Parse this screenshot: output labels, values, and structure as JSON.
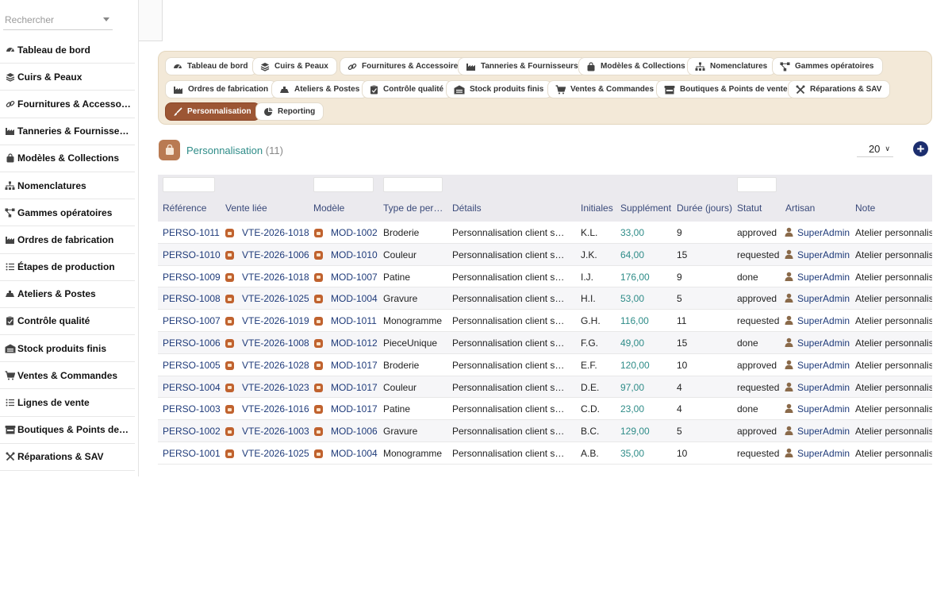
{
  "search": {
    "placeholder": "Rechercher"
  },
  "sidebar": {
    "items": [
      {
        "label": "Tableau de bord",
        "icon": "dashboard-icon"
      },
      {
        "label": "Cuirs & Peaux",
        "icon": "layers-icon"
      },
      {
        "label": "Fournitures & Accessoires",
        "icon": "link-icon"
      },
      {
        "label": "Tanneries & Fournisseurs",
        "icon": "factory-icon"
      },
      {
        "label": "Modèles & Collections",
        "icon": "bag-icon"
      },
      {
        "label": "Nomenclatures",
        "icon": "sitemap-icon"
      },
      {
        "label": "Gammes opératoires",
        "icon": "flow-icon"
      },
      {
        "label": "Ordres de fabrication",
        "icon": "factory-icon"
      },
      {
        "label": "Étapes de production",
        "icon": "list-icon"
      },
      {
        "label": "Ateliers & Postes",
        "icon": "workshop-icon"
      },
      {
        "label": "Contrôle qualité",
        "icon": "clipboard-check-icon"
      },
      {
        "label": "Stock produits finis",
        "icon": "warehouse-icon"
      },
      {
        "label": "Ventes & Commandes",
        "icon": "cart-icon"
      },
      {
        "label": "Lignes de vente",
        "icon": "list-icon"
      },
      {
        "label": "Boutiques & Points de vente",
        "icon": "store-icon"
      },
      {
        "label": "Réparations & SAV",
        "icon": "tools-icon"
      }
    ]
  },
  "tabs": [
    {
      "label": "Tableau de bord",
      "icon": "dashboard-icon"
    },
    {
      "label": "Cuirs & Peaux",
      "icon": "layers-icon"
    },
    {
      "label": "Fournitures & Accessoires",
      "icon": "link-icon"
    },
    {
      "label": "Tanneries & Fournisseurs",
      "icon": "factory-icon"
    },
    {
      "label": "Modèles & Collections",
      "icon": "bag-icon"
    },
    {
      "label": "Nomenclatures",
      "icon": "sitemap-icon"
    },
    {
      "label": "Gammes opératoires",
      "icon": "flow-icon"
    },
    {
      "label": "Ordres de fabrication",
      "icon": "factory-icon"
    },
    {
      "label": "Ateliers & Postes",
      "icon": "workshop-icon"
    },
    {
      "label": "Contrôle qualité",
      "icon": "clipboard-check-icon"
    },
    {
      "label": "Stock produits finis",
      "icon": "warehouse-icon"
    },
    {
      "label": "Ventes & Commandes",
      "icon": "cart-icon"
    },
    {
      "label": "Boutiques & Points de vente",
      "icon": "store-icon"
    },
    {
      "label": "Réparations & SAV",
      "icon": "tools-icon"
    },
    {
      "label": "Personnalisation",
      "icon": "brush-icon",
      "active": true
    },
    {
      "label": "Reporting",
      "icon": "chart-pie-icon"
    }
  ],
  "header": {
    "title": "Personnalisation",
    "count": "(11)",
    "per_page": "20",
    "add_label": "+"
  },
  "table": {
    "columns": [
      "Référence",
      "Vente liée",
      "Modèle",
      "Type de personnalisation",
      "Détails",
      "Initiales",
      "Supplément",
      "Durée (jours)",
      "Statut",
      "Artisan",
      "Note"
    ],
    "rows": [
      [
        "PERSO-1011",
        "VTE-2026-1018",
        "MOD-1002",
        "Broderie",
        "Personnalisation client sur mesure",
        "K.L.",
        "33,00",
        "9",
        "approved",
        "SuperAdmin",
        "Atelier personnalisation"
      ],
      [
        "PERSO-1010",
        "VTE-2026-1006",
        "MOD-1010",
        "Couleur",
        "Personnalisation client sur mesure",
        "J.K.",
        "64,00",
        "15",
        "requested",
        "SuperAdmin",
        "Atelier personnalisation"
      ],
      [
        "PERSO-1009",
        "VTE-2026-1018",
        "MOD-1007",
        "Patine",
        "Personnalisation client sur mesure",
        "I.J.",
        "176,00",
        "9",
        "done",
        "SuperAdmin",
        "Atelier personnalisation"
      ],
      [
        "PERSO-1008",
        "VTE-2026-1025",
        "MOD-1004",
        "Gravure",
        "Personnalisation client sur mesure",
        "H.I.",
        "53,00",
        "5",
        "approved",
        "SuperAdmin",
        "Atelier personnalisation"
      ],
      [
        "PERSO-1007",
        "VTE-2026-1019",
        "MOD-1011",
        "Monogramme",
        "Personnalisation client sur mesure",
        "G.H.",
        "116,00",
        "11",
        "requested",
        "SuperAdmin",
        "Atelier personnalisation"
      ],
      [
        "PERSO-1006",
        "VTE-2026-1008",
        "MOD-1012",
        "PieceUnique",
        "Personnalisation client sur mesure",
        "F.G.",
        "49,00",
        "15",
        "done",
        "SuperAdmin",
        "Atelier personnalisation"
      ],
      [
        "PERSO-1005",
        "VTE-2026-1028",
        "MOD-1017",
        "Broderie",
        "Personnalisation client sur mesure",
        "E.F.",
        "120,00",
        "10",
        "approved",
        "SuperAdmin",
        "Atelier personnalisation"
      ],
      [
        "PERSO-1004",
        "VTE-2026-1023",
        "MOD-1017",
        "Couleur",
        "Personnalisation client sur mesure",
        "D.E.",
        "97,00",
        "4",
        "requested",
        "SuperAdmin",
        "Atelier personnalisation"
      ],
      [
        "PERSO-1003",
        "VTE-2026-1016",
        "MOD-1017",
        "Patine",
        "Personnalisation client sur mesure",
        "C.D.",
        "23,00",
        "4",
        "done",
        "SuperAdmin",
        "Atelier personnalisation"
      ],
      [
        "PERSO-1002",
        "VTE-2026-1003",
        "MOD-1006",
        "Gravure",
        "Personnalisation client sur mesure",
        "B.C.",
        "129,00",
        "5",
        "approved",
        "SuperAdmin",
        "Atelier personnalisation"
      ],
      [
        "PERSO-1001",
        "VTE-2026-1025",
        "MOD-1004",
        "Monogramme",
        "Personnalisation client sur mesure",
        "A.B.",
        "35,00",
        "10",
        "requested",
        "SuperAdmin",
        "Atelier personnalisation"
      ]
    ]
  },
  "colors": {
    "accent": "#9c5634",
    "link": "#1f3b7a",
    "teal": "#2e8c88",
    "tab_panel": "#f3e9d8",
    "add_button": "#1c2e6e"
  }
}
